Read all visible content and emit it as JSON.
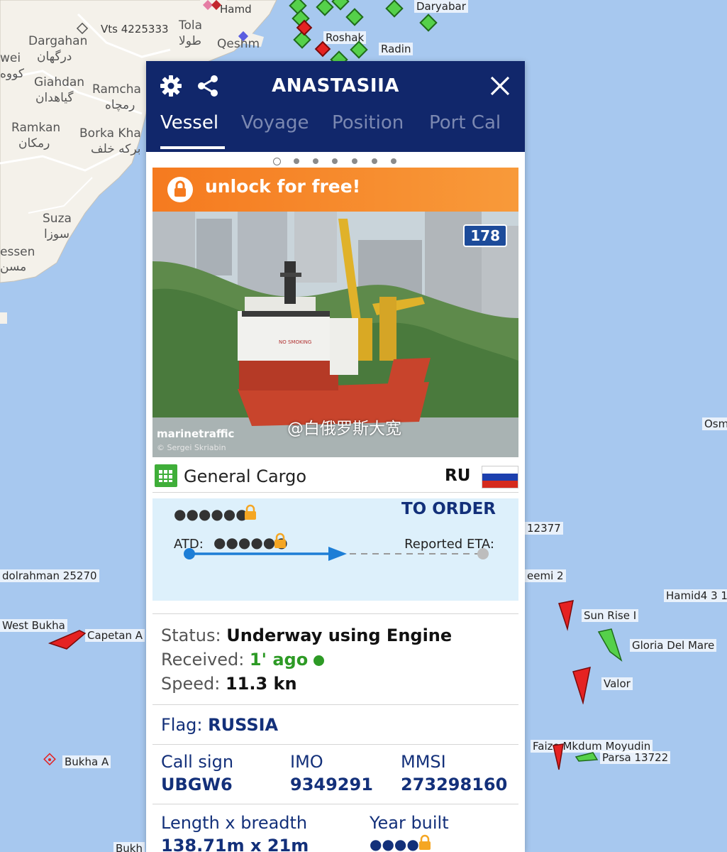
{
  "map": {
    "place_labels": [
      {
        "id": "hamd",
        "text": "Hamd"
      },
      {
        "id": "vts",
        "text": "Vts 4225333"
      },
      {
        "id": "tola",
        "text": "Tola"
      },
      {
        "id": "tola_fa",
        "text": "طولا"
      },
      {
        "id": "dargahan",
        "text": "Dargahan"
      },
      {
        "id": "dargahan_fa",
        "text": "درگهان"
      },
      {
        "id": "qeshm",
        "text": "Qeshm"
      },
      {
        "id": "giahdan",
        "text": "Giahdan"
      },
      {
        "id": "giahdan_fa",
        "text": "گیاهدان"
      },
      {
        "id": "ramcha",
        "text": "Ramcha"
      },
      {
        "id": "ramcha_fa",
        "text": "رمچاه"
      },
      {
        "id": "ramkan",
        "text": "Ramkan"
      },
      {
        "id": "ramkan_fa",
        "text": "رمکان"
      },
      {
        "id": "borka",
        "text": "Borka Kha"
      },
      {
        "id": "borka_fa",
        "text": "برکه خلف"
      },
      {
        "id": "suza",
        "text": "Suza"
      },
      {
        "id": "suza_fa",
        "text": "سوزا"
      },
      {
        "id": "essen",
        "text": "essen"
      },
      {
        "id": "essen_fa",
        "text": "مسن"
      },
      {
        "id": "wei",
        "text": "wei"
      },
      {
        "id": "wei_fa",
        "text": "کووه"
      }
    ],
    "vessel_labels": [
      {
        "id": "daryabar",
        "text": "Daryabar"
      },
      {
        "id": "roshak",
        "text": "Roshak"
      },
      {
        "id": "radin",
        "text": "Radin"
      },
      {
        "id": "osm",
        "text": "Osm"
      },
      {
        "id": "n12377",
        "text": "12377"
      },
      {
        "id": "dolrahman",
        "text": "dolrahman 25270"
      },
      {
        "id": "eemi2",
        "text": "eemi 2"
      },
      {
        "id": "hamid4",
        "text": "Hamid4 3 1"
      },
      {
        "id": "west_bukha",
        "text": "West Bukha"
      },
      {
        "id": "capetan",
        "text": "Capetan A"
      },
      {
        "id": "sunrise",
        "text": "Sun Rise I"
      },
      {
        "id": "gloria",
        "text": "Gloria Del Mare"
      },
      {
        "id": "valor",
        "text": "Valor"
      },
      {
        "id": "faize",
        "text": "Faize Mkdum Moyudin"
      },
      {
        "id": "parsa",
        "text": "Parsa 13722"
      },
      {
        "id": "bukha_a",
        "text": "Bukha A"
      },
      {
        "id": "bukh",
        "text": "Bukh"
      }
    ]
  },
  "panel": {
    "title": "ANASTASIIA",
    "tabs": [
      {
        "label": "Vessel",
        "active": true
      },
      {
        "label": "Voyage",
        "active": false
      },
      {
        "label": "Position",
        "active": false
      },
      {
        "label": "Port Cal",
        "active": false
      }
    ],
    "carousel_dots": 7,
    "unlock_label": "unlock for free!",
    "photo": {
      "count": "178",
      "brand": "marinetraffic",
      "credit": "© Sergei Skriabin",
      "watermark": "@白俄罗斯大宽",
      "ship_text": "NO SMOKING"
    },
    "vessel_type": "General Cargo",
    "country_code": "RU",
    "voyage": {
      "destination": "TO ORDER",
      "masked_departure": "●●●●●●",
      "atd_label": "ATD:",
      "atd_masked": "●●●●●●",
      "eta_label": "Reported ETA:"
    },
    "status": {
      "status_label": "Status:",
      "status_value": "Underway using Engine",
      "received_label": "Received:",
      "received_value": "1' ago",
      "speed_label": "Speed:",
      "speed_value": "11.3 kn"
    },
    "flag": {
      "label": "Flag:",
      "value": "RUSSIA"
    },
    "ids": {
      "call_sign_label": "Call sign",
      "call_sign": "UBGW6",
      "imo_label": "IMO",
      "imo": "9349291",
      "mmsi_label": "MMSI",
      "mmsi": "273298160"
    },
    "dimensions": {
      "length_label": "Length x breadth",
      "length_value": "138.71m x 21m",
      "year_label": "Year built",
      "year_masked": "●●●●"
    }
  },
  "colors": {
    "header": "#11276b",
    "unlock": "#f57a1f",
    "voyage_box": "#ddf0fb",
    "accent_navy": "#13307a",
    "status_green": "#2d9a25",
    "lock": "#f5a623",
    "sea": "#a7c8ef",
    "land": "#f4f1ea"
  },
  "icons": [
    "gear-icon",
    "share-icon",
    "close-icon",
    "lock-icon",
    "cargo-type-icon",
    "flag-russia-icon"
  ]
}
